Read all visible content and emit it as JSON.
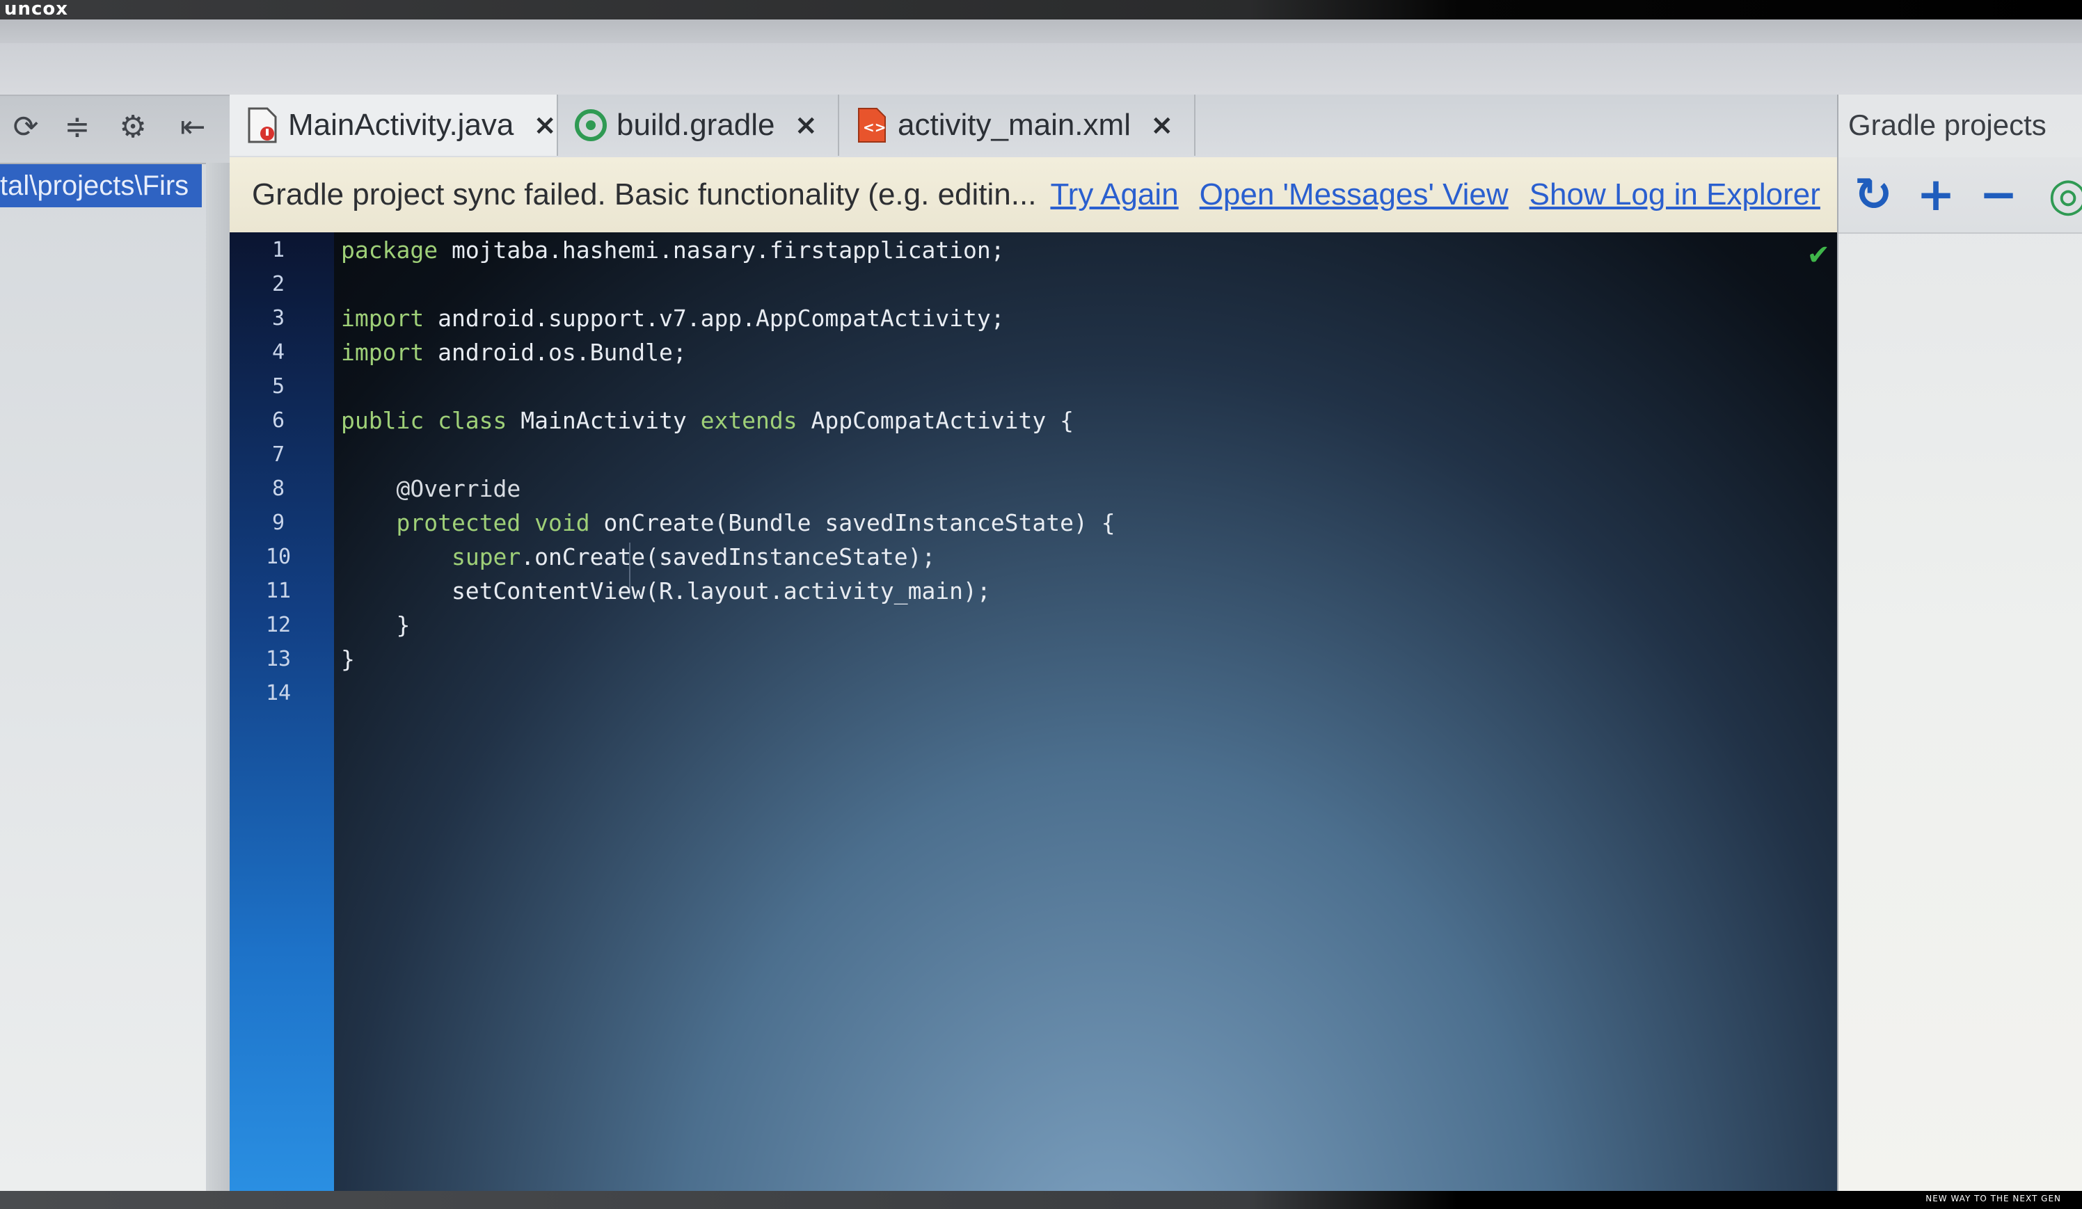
{
  "watermark": "uncox",
  "footer_text": "NEW WAY TO THE NEXT GEN",
  "project_path": "tal\\projects\\Firs",
  "tabs": [
    {
      "label": "MainActivity.java",
      "icon": "java-file-icon"
    },
    {
      "label": "build.gradle",
      "icon": "gradle-file-icon"
    },
    {
      "label": "activity_main.xml",
      "icon": "xml-file-icon"
    }
  ],
  "close_glyph": "×",
  "banner": {
    "message": "Gradle project sync failed. Basic functionality (e.g. editin...",
    "try_again": "Try Again",
    "open_messages": "Open 'Messages' View",
    "show_log": "Show Log in Explorer"
  },
  "right_panel": {
    "title": "Gradle projects"
  },
  "colors": {
    "link": "#2a5fcf",
    "keyword": "#9fd078",
    "selection": "#2f63c2",
    "banner": "#f2eedc"
  },
  "line_numbers": [
    "1",
    "2",
    "3",
    "4",
    "5",
    "6",
    "7",
    "8",
    "9",
    "10",
    "11",
    "12",
    "13",
    "14"
  ],
  "code": {
    "l1_kw": "package",
    "l1_rest": " mojtaba.hashemi.nasary.firstapplication;",
    "l3_kw": "import",
    "l3_rest": " android.support.v7.app.AppCompatActivity;",
    "l4_kw": "import",
    "l4_rest": " android.os.Bundle;",
    "l6_kw1": "public class",
    "l6_mid": " MainActivity ",
    "l6_kw2": "extends",
    "l6_rest": " AppCompatActivity {",
    "l8": "    @Override",
    "l9_indent": "    ",
    "l9_kw": "protected void",
    "l9_rest": " onCreate(Bundle savedInstanceState) {",
    "l10_indent": "        ",
    "l10_kw": "super",
    "l10_rest": ".onCreate(savedInstanceState);",
    "l11": "        setContentView(R.layout.activity_main);",
    "l12": "    }",
    "l13": "}"
  }
}
